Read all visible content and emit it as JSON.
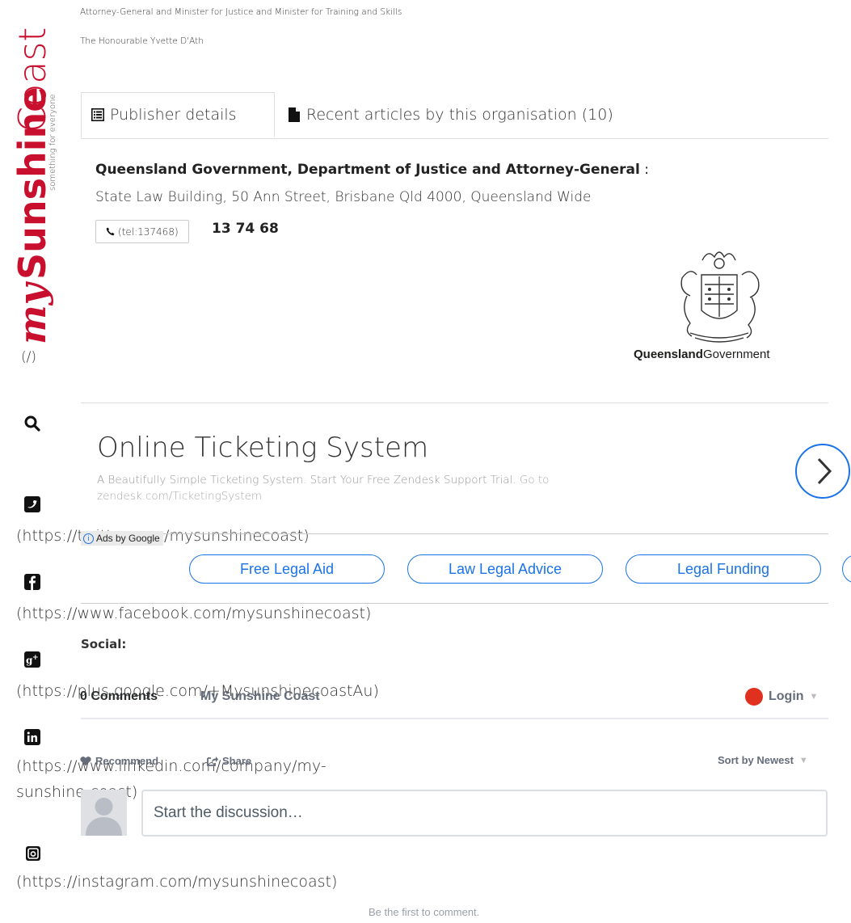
{
  "header": {
    "line1": "Attorney-General and Minister for Justice and Minister for Training and Skills",
    "line2": "The Honourable Yvette D'Ath"
  },
  "logo": {
    "brand_my": "my",
    "brand_sunshine": "Sunshine",
    "brand_coast": "Coast",
    "tagline": "something for everyone",
    "link_text": "(/)"
  },
  "rail": {
    "twitter_url": "(https://twitter.com/mysunshinecoast)",
    "facebook_url": "(https://www.facebook.com/mysunshinecoast)",
    "google_url": "(https://plus.google.com/+MysunshinecoastAu)",
    "linkedin_url": "(https://www.linkedin.com/company/my-sunshine-coast)",
    "instagram_url": "(https://instagram.com/mysunshinecoast)"
  },
  "tabs": {
    "publisher": "Publisher details",
    "recent": "Recent articles by this organisation (10)"
  },
  "publisher": {
    "name": "Queensland Government, Department of Justice and Attorney-General",
    "name_suffix": " :",
    "address": "State Law Building, 50 Ann Street, Brisbane Qld 4000, Queensland Wide",
    "phone_link": "(tel:137468)",
    "phone_display": "13 74 68",
    "logo_text_bold": "Queensland",
    "logo_text": " Government"
  },
  "ad": {
    "title": "Online Ticketing System",
    "description": "A Beautifully Simple Ticketing System. Start Your Free Zendesk Support Trial.",
    "description_link": " Go to zendesk.com/TicketingSystem",
    "badge": "Ads by Google",
    "pills": [
      "Free Legal Aid",
      "Law Legal Advice",
      "Legal Funding"
    ]
  },
  "social_label": "Social:",
  "comments": {
    "count": "0 Comments",
    "site": "My Sunshine Coast",
    "login": "Login",
    "recommend": "Recommend",
    "share": "Share",
    "sort": "Sort by Newest",
    "placeholder": "Start the discussion…",
    "first": "Be the first to comment."
  },
  "colors": {
    "accent_blue": "#1a73e8",
    "logo_red": "#c8102e",
    "logo_dark": "#333333",
    "disqus_red": "#e0311e"
  }
}
